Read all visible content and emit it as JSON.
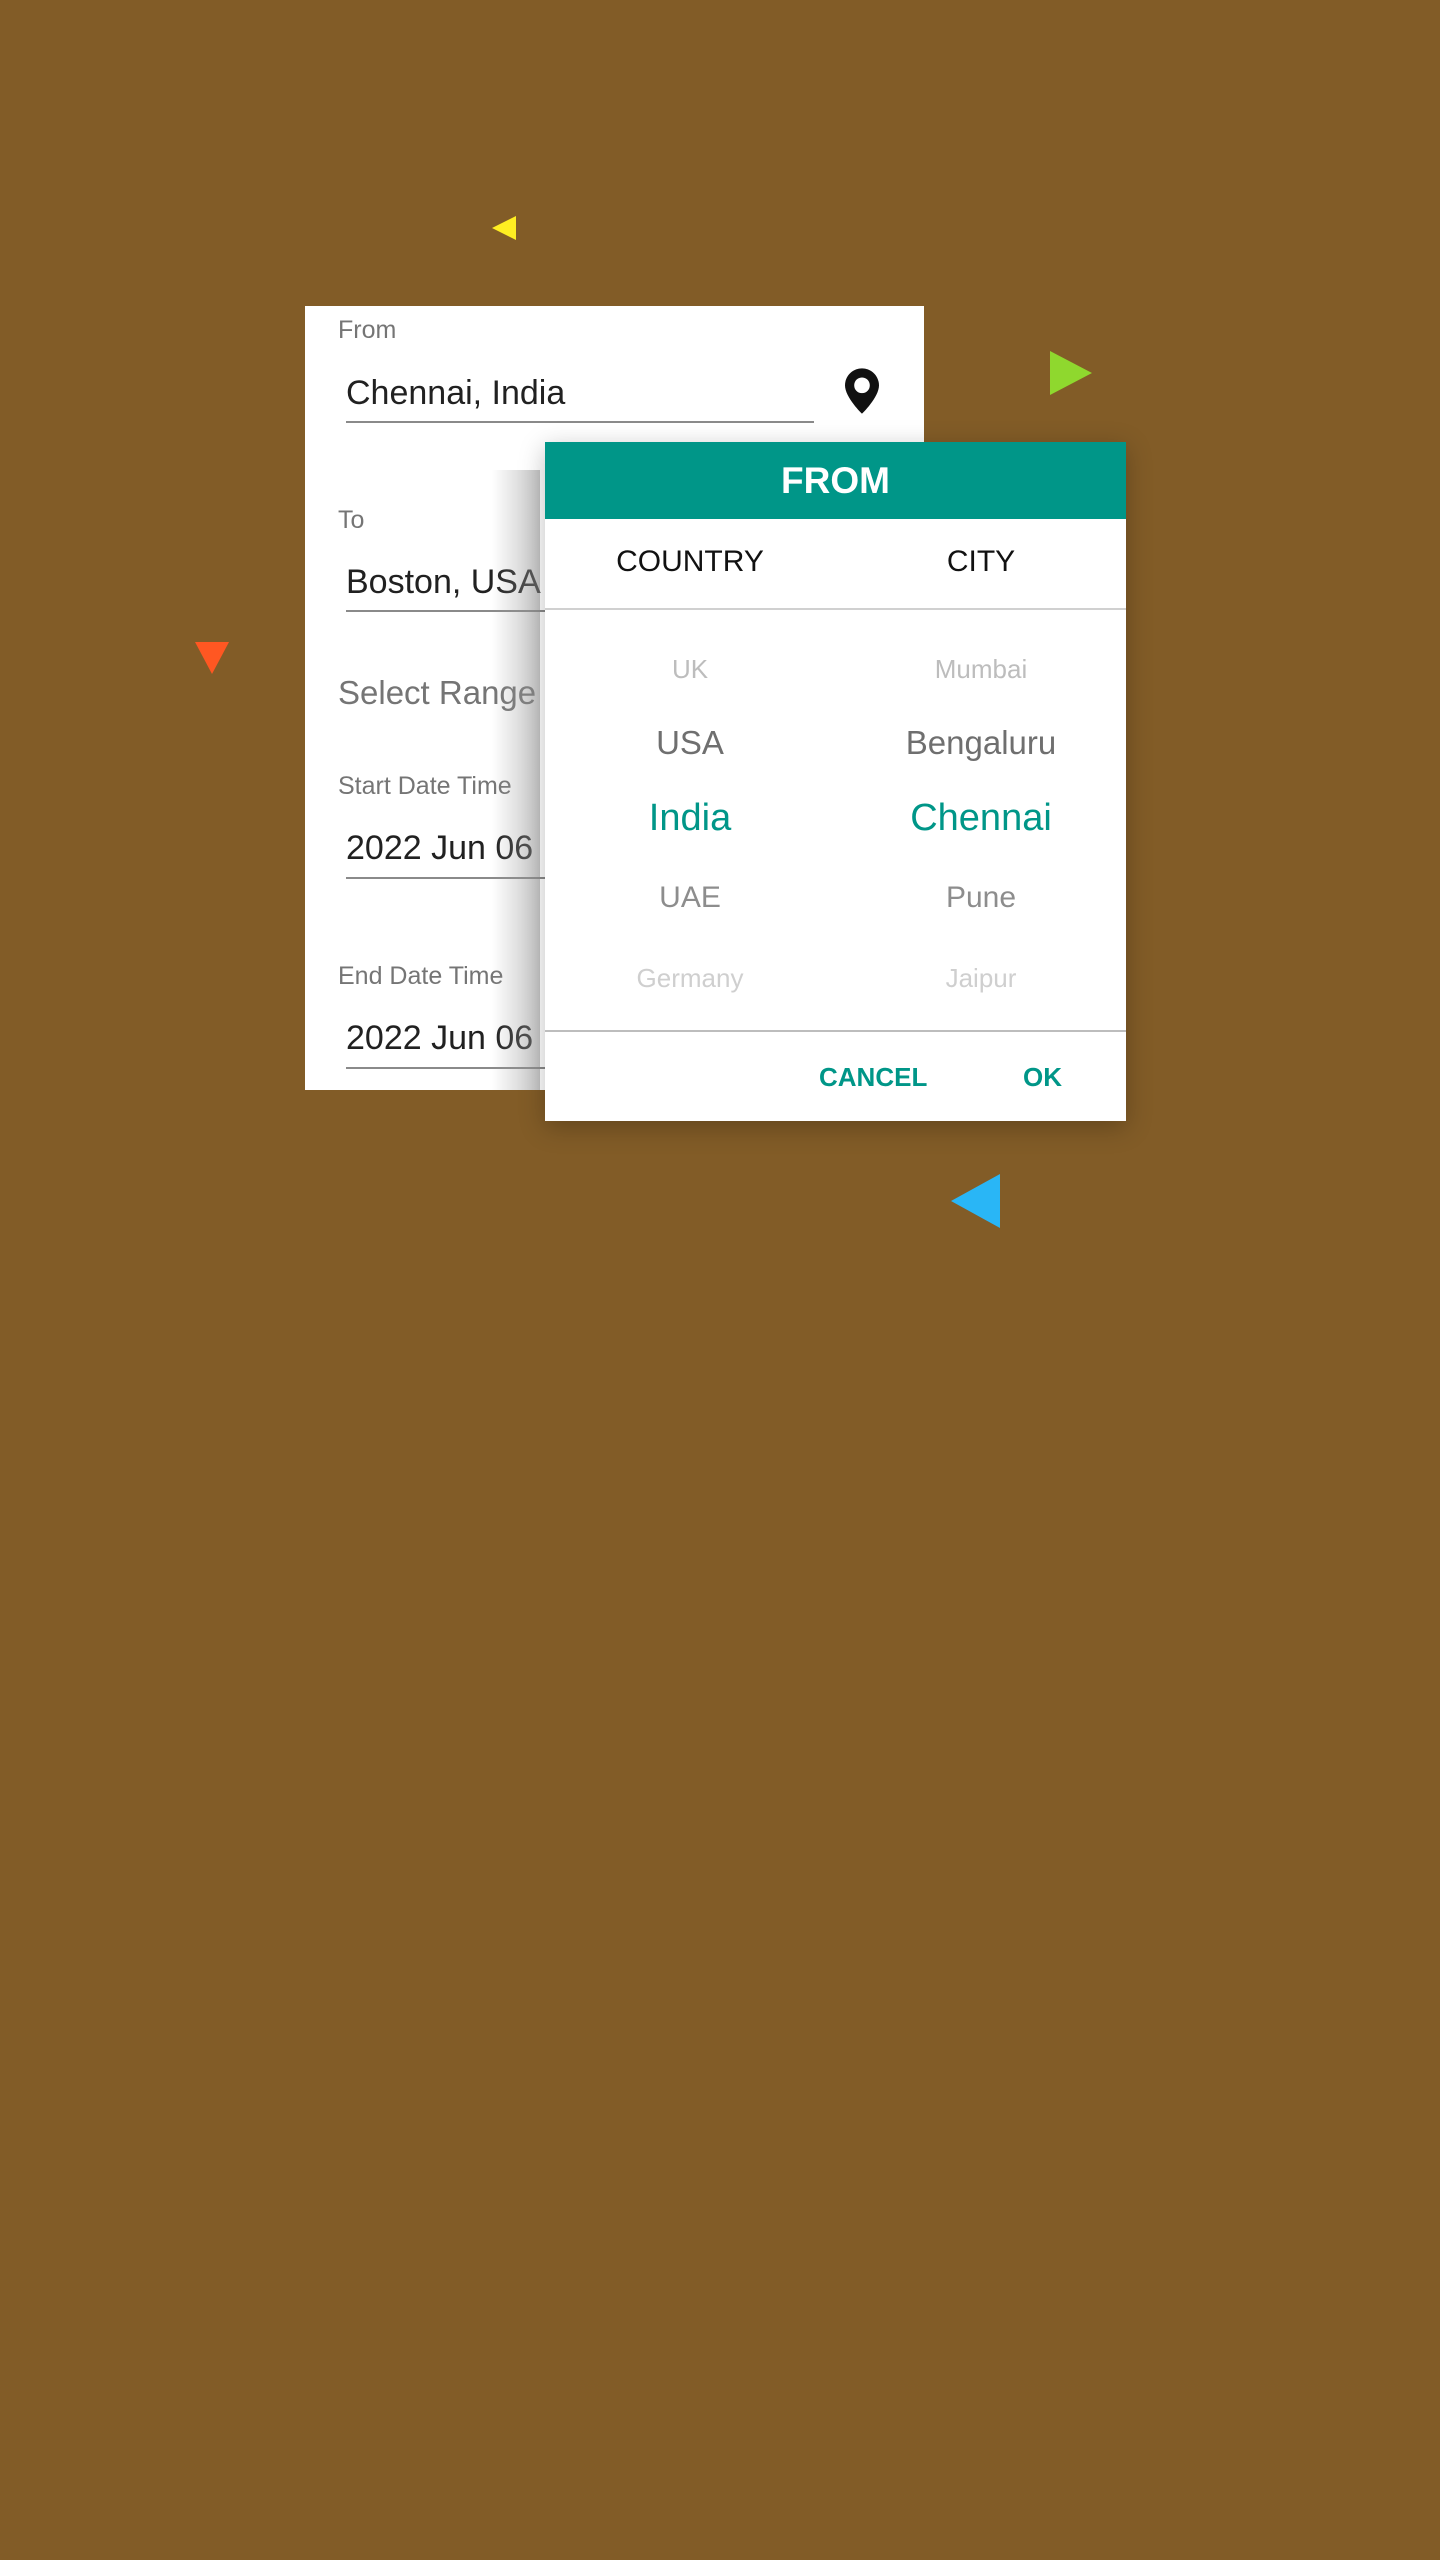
{
  "form": {
    "from_label": "From",
    "from_value": "Chennai, India",
    "to_label": "To",
    "to_value": "Boston, USA",
    "range_title": "Select Range",
    "start_label": "Start Date Time",
    "start_value": "2022 Jun 06",
    "end_label": "End Date Time",
    "end_value": "2022 Jun 06"
  },
  "dialog": {
    "title": "FROM",
    "country_header": "COUNTRY",
    "city_header": "CITY",
    "countries": [
      "UK",
      "USA",
      "India",
      "UAE",
      "Germany"
    ],
    "cities": [
      "Mumbai",
      "Bengaluru",
      "Chennai",
      "Pune",
      "Jaipur"
    ],
    "selected_country": "India",
    "selected_city": "Chennai",
    "cancel_label": "CANCEL",
    "ok_label": "OK"
  },
  "colors": {
    "background": "#825c27",
    "accent": "#009688",
    "decor_yellow": "#ffee22",
    "decor_green": "#8fd82e",
    "decor_red": "#ff5722",
    "decor_blue": "#29b6f6"
  },
  "icons": {
    "location": "location-pin-icon"
  }
}
